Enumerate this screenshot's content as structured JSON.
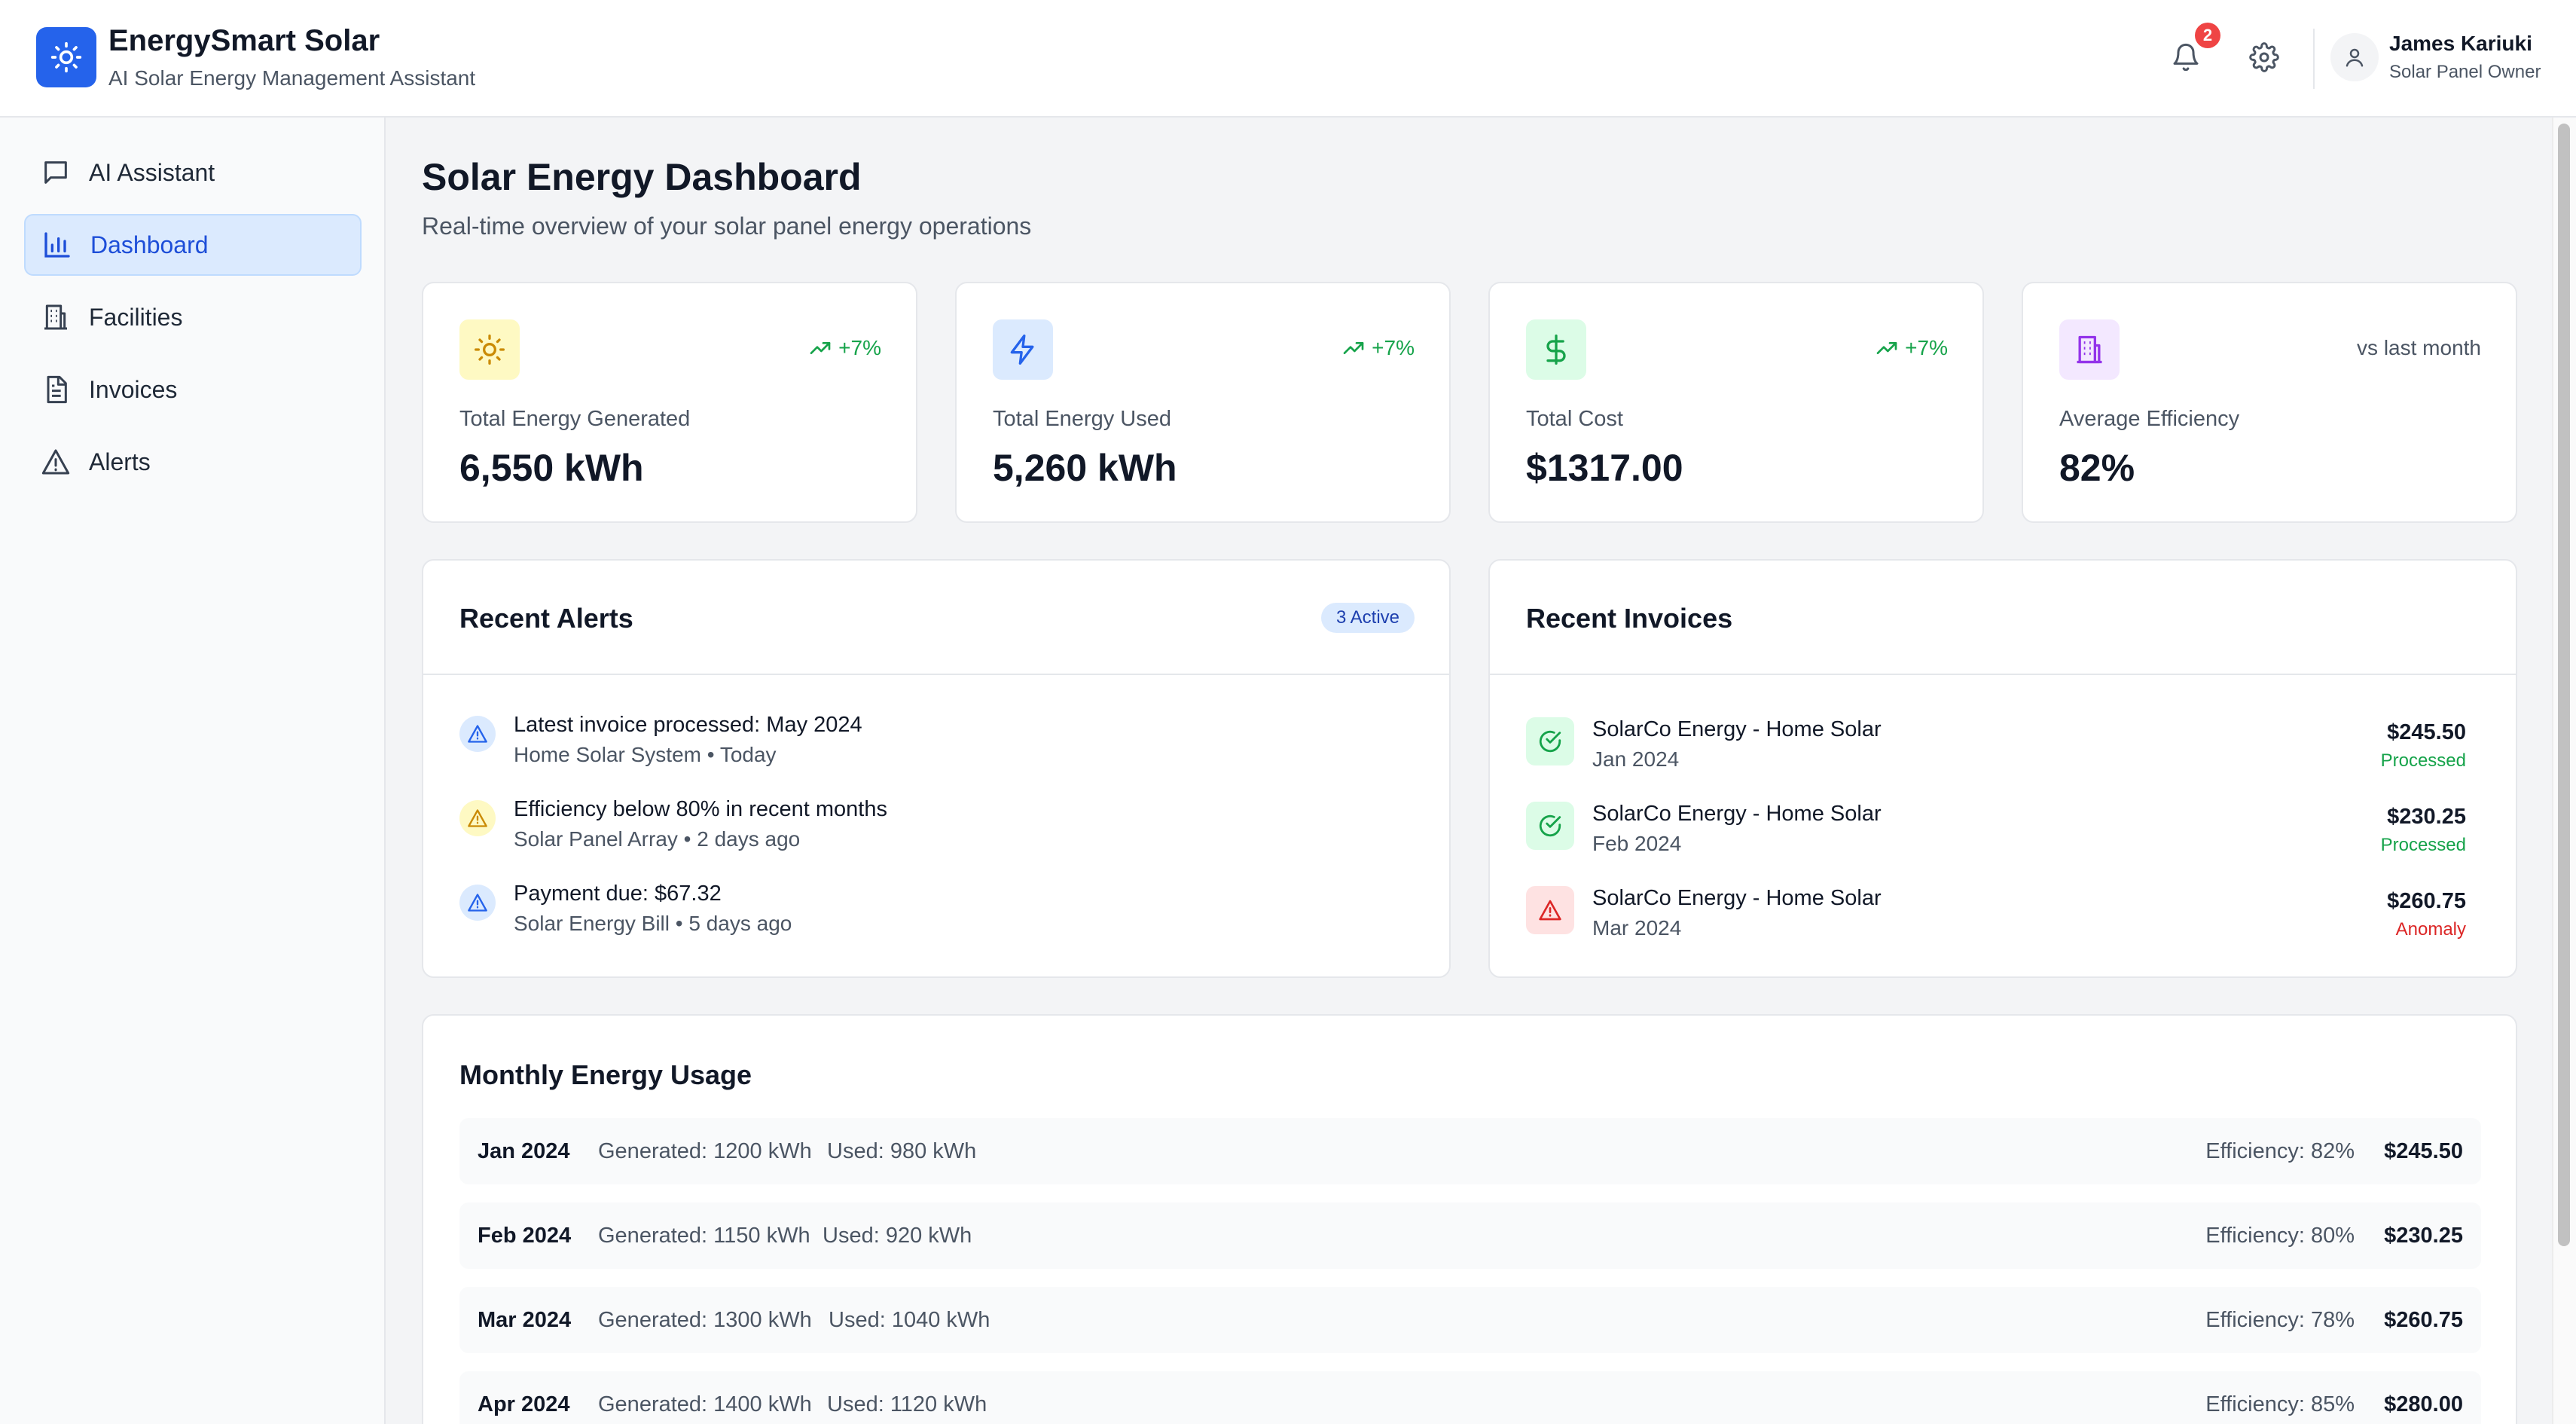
{
  "header": {
    "app_name": "EnergySmart Solar",
    "app_tagline": "AI Solar Energy Management Assistant",
    "notification_count": "2",
    "user_name": "James Kariuki",
    "user_role": "Solar Panel Owner"
  },
  "sidebar": {
    "items": [
      {
        "label": "AI Assistant",
        "icon": "chat-icon",
        "active": false
      },
      {
        "label": "Dashboard",
        "icon": "bar-chart-icon",
        "active": true
      },
      {
        "label": "Facilities",
        "icon": "building-icon",
        "active": false
      },
      {
        "label": "Invoices",
        "icon": "document-icon",
        "active": false
      },
      {
        "label": "Alerts",
        "icon": "warning-icon",
        "active": false
      }
    ]
  },
  "page": {
    "title": "Solar Energy Dashboard",
    "subtitle": "Real-time overview of your solar panel energy operations"
  },
  "stats": [
    {
      "label": "Total Energy Generated",
      "value": "6,550 kWh",
      "trend": "+7%",
      "icon": "sun-icon",
      "accent": "#ca8a04"
    },
    {
      "label": "Total Energy Used",
      "value": "5,260 kWh",
      "trend": "+7%",
      "icon": "lightning-icon",
      "accent": "#2563eb"
    },
    {
      "label": "Total Cost",
      "value": "$1317.00",
      "trend": "+7%",
      "icon": "dollar-icon",
      "accent": "#16a34a"
    },
    {
      "label": "Average Efficiency",
      "value": "82%",
      "trend": "vs last month",
      "icon": "building-icon",
      "accent": "#9333ea"
    }
  ],
  "alerts": {
    "title": "Recent Alerts",
    "badge": "3 Active",
    "items": [
      {
        "title": "Latest invoice processed: May 2024",
        "meta": "Home Solar System • Today",
        "severity": "info"
      },
      {
        "title": "Efficiency below 80% in recent months",
        "meta": "Solar Panel Array • 2 days ago",
        "severity": "warning"
      },
      {
        "title": "Payment due: $67.32",
        "meta": "Solar Energy Bill • 5 days ago",
        "severity": "info"
      }
    ]
  },
  "invoices": {
    "title": "Recent Invoices",
    "items": [
      {
        "title": "SolarCo Energy - Home Solar",
        "date": "Jan 2024",
        "amount": "$245.50",
        "status": "Processed"
      },
      {
        "title": "SolarCo Energy - Home Solar",
        "date": "Feb 2024",
        "amount": "$230.25",
        "status": "Processed"
      },
      {
        "title": "SolarCo Energy - Home Solar",
        "date": "Mar 2024",
        "amount": "$260.75",
        "status": "Anomaly"
      }
    ]
  },
  "usage": {
    "title": "Monthly Energy Usage",
    "rows": [
      {
        "month": "Jan 2024",
        "generated": "Generated: 1200 kWh",
        "used": "Used: 980 kWh",
        "efficiency": "Efficiency: 82%",
        "cost": "$245.50"
      },
      {
        "month": "Feb 2024",
        "generated": "Generated: 1150 kWh",
        "used": "Used: 920 kWh",
        "efficiency": "Efficiency: 80%",
        "cost": "$230.25"
      },
      {
        "month": "Mar 2024",
        "generated": "Generated: 1300 kWh",
        "used": "Used: 1040 kWh",
        "efficiency": "Efficiency: 78%",
        "cost": "$260.75"
      },
      {
        "month": "Apr 2024",
        "generated": "Generated: 1400 kWh",
        "used": "Used: 1120 kWh",
        "efficiency": "Efficiency: 85%",
        "cost": "$280.00"
      }
    ]
  },
  "colors": {
    "primary": "#2563eb",
    "success": "#16a34a",
    "danger": "#dc2626",
    "warning": "#ca8a04"
  }
}
